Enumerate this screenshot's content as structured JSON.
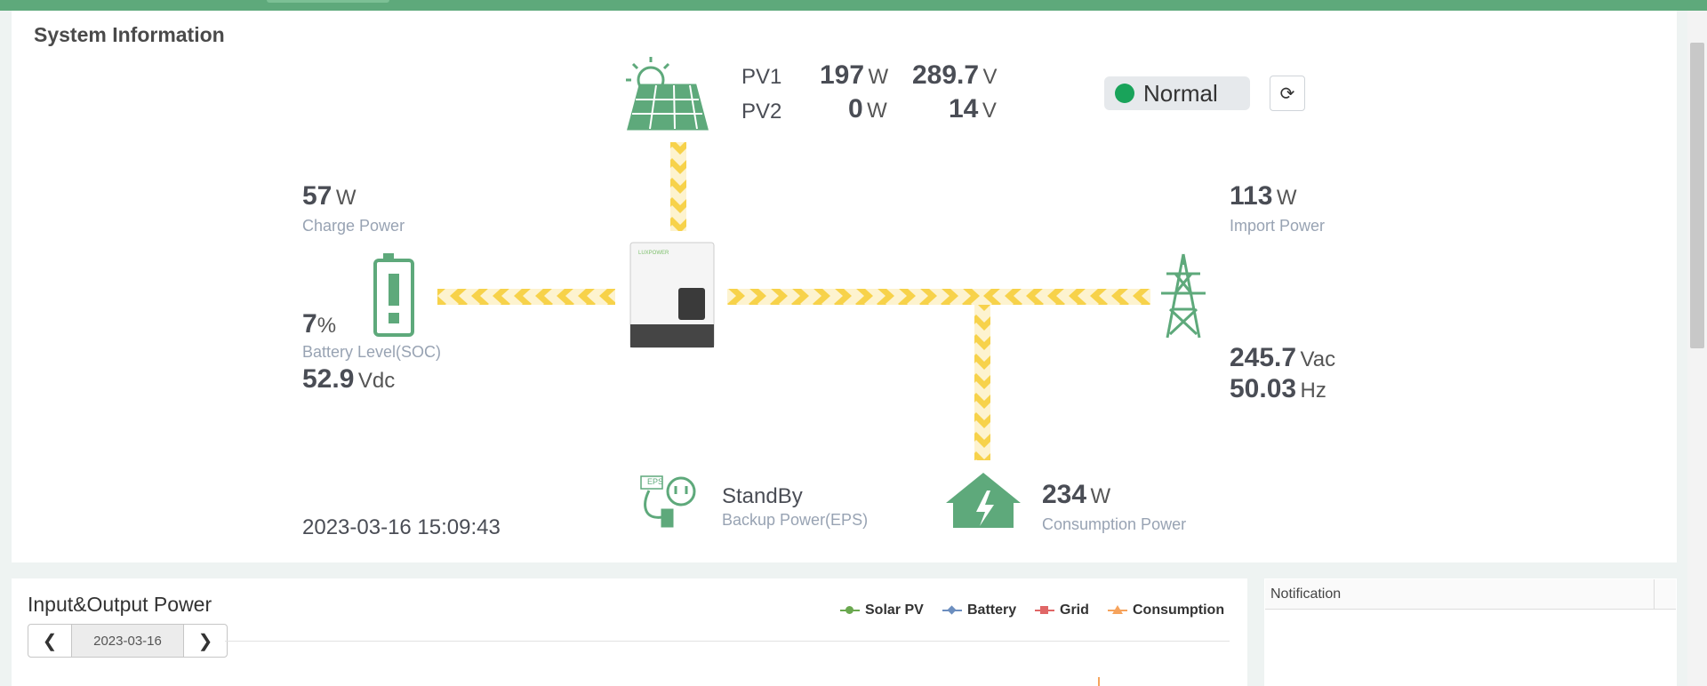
{
  "system_info": {
    "title": "System Information",
    "pv1": {
      "label": "PV1",
      "power": "197",
      "power_unit": "W",
      "voltage": "289.7",
      "voltage_unit": "V"
    },
    "pv2": {
      "label": "PV2",
      "power": "0",
      "power_unit": "W",
      "voltage": "14",
      "voltage_unit": "V"
    },
    "status": "Normal",
    "status_color": "#19a35a",
    "refresh_icon": "refresh-icon",
    "battery": {
      "charge_power": "57",
      "charge_power_unit": "W",
      "charge_power_label": "Charge Power",
      "soc": "7",
      "soc_unit": "%",
      "soc_label": "Battery Level(SOC)",
      "voltage": "52.9",
      "voltage_unit": "Vdc"
    },
    "grid": {
      "import_power": "113",
      "import_power_unit": "W",
      "import_power_label": "Import Power",
      "voltage": "245.7",
      "voltage_unit": "Vac",
      "frequency": "50.03",
      "frequency_unit": "Hz"
    },
    "eps": {
      "status": "StandBy",
      "label": "Backup Power(EPS)",
      "badge": "EPS"
    },
    "consumption": {
      "power": "234",
      "power_unit": "W",
      "label": "Consumption Power"
    },
    "timestamp": "2023-03-16 15:09:43",
    "inverter_brand": "LUXPOWER",
    "accent_color": "#5ea97b",
    "flow_color": "#f7d24a"
  },
  "io_power": {
    "title": "Input&Output Power",
    "date": "2023-03-16",
    "prev_icon": "chevron-left-icon",
    "next_icon": "chevron-right-icon",
    "legend": [
      {
        "name": "Solar PV",
        "color": "#6aa84f"
      },
      {
        "name": "Battery",
        "color": "#6c8ebf"
      },
      {
        "name": "Grid",
        "color": "#e06666"
      },
      {
        "name": "Consumption",
        "color": "#f6a35c"
      }
    ]
  },
  "notification": {
    "title": "Notification"
  }
}
